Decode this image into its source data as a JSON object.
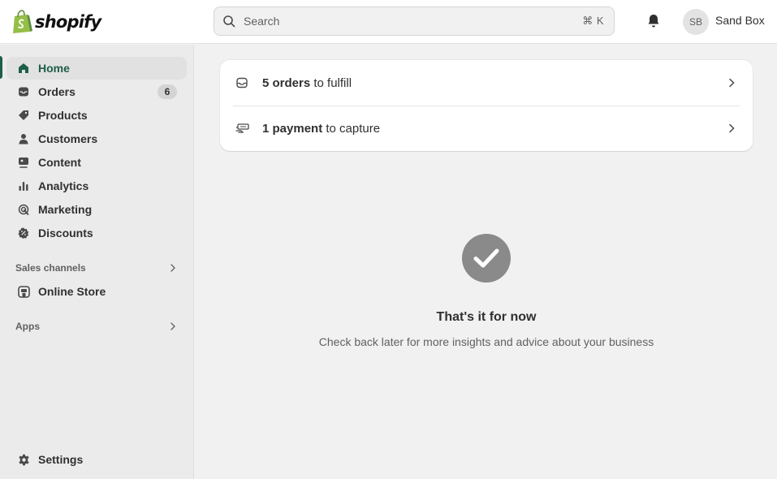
{
  "brand": {
    "name": "shopify",
    "color": "#95bf47"
  },
  "search": {
    "placeholder": "Search",
    "shortcut": "⌘ K"
  },
  "account": {
    "initials": "SB",
    "store_name": "Sand Box"
  },
  "sidebar": {
    "items": [
      {
        "label": "Home",
        "icon": "home-icon",
        "active": true
      },
      {
        "label": "Orders",
        "icon": "inbox-icon",
        "badge": "6"
      },
      {
        "label": "Products",
        "icon": "tag-icon"
      },
      {
        "label": "Customers",
        "icon": "person-icon"
      },
      {
        "label": "Content",
        "icon": "content-icon"
      },
      {
        "label": "Analytics",
        "icon": "bar-chart-icon"
      },
      {
        "label": "Marketing",
        "icon": "target-icon"
      },
      {
        "label": "Discounts",
        "icon": "discount-icon"
      }
    ],
    "sales_channels": {
      "label": "Sales channels",
      "items": [
        {
          "label": "Online Store",
          "icon": "store-icon"
        }
      ]
    },
    "apps": {
      "label": "Apps"
    },
    "settings": {
      "label": "Settings",
      "icon": "gear-icon"
    }
  },
  "tasks": [
    {
      "bold": "5 orders",
      "rest": " to fulfill",
      "icon": "inbox-icon"
    },
    {
      "bold": "1 payment",
      "rest": " to capture",
      "icon": "cash-icon"
    }
  ],
  "empty_state": {
    "title": "That's it for now",
    "subtitle": "Check back later for more insights and advice about your business"
  },
  "colors": {
    "accent": "#1f5e4a",
    "background": "#f1f1f1",
    "sidebar": "#ebebeb"
  }
}
